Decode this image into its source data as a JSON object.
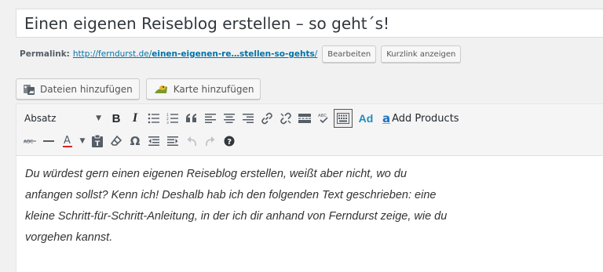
{
  "post": {
    "title": "Einen eigenen Reiseblog erstellen – so geht´s!",
    "permalink_label": "Permalink:",
    "permalink_base": "http://ferndurst.de/",
    "permalink_slug": "einen-eigenen-re…stellen-so-gehts",
    "permalink_trailing": "/",
    "edit_button": "Bearbeiten",
    "shortlink_button": "Kurzlink anzeigen"
  },
  "media": {
    "add_files": "Dateien hinzufügen",
    "add_map": "Karte hinzufügen"
  },
  "toolbar": {
    "format_select": "Absatz",
    "bold": "B",
    "italic": "I",
    "ad_label": "Ad",
    "amazon_letter": "a",
    "add_products": "Add Products",
    "icons_row1": [
      "bold-icon",
      "italic-icon",
      "bullet-list-icon",
      "numbered-list-icon",
      "blockquote-icon",
      "align-left-icon",
      "align-center-icon",
      "align-right-icon",
      "link-icon",
      "unlink-icon",
      "read-more-icon",
      "spellcheck-icon",
      "toolbar-toggle-icon",
      "ad-icon",
      "amazon-icon"
    ],
    "icons_row2": [
      "strikethrough-icon",
      "horizontal-line-icon",
      "text-color-icon",
      "paste-as-text-icon",
      "clear-formatting-icon",
      "special-character-icon",
      "outdent-icon",
      "indent-icon",
      "undo-icon",
      "redo-icon",
      "help-icon"
    ]
  },
  "content": {
    "lines": [
      "Du würdest gern einen eigenen Reiseblog erstellen, weißt aber nicht, wo du",
      "anfangen sollst? Kenn ich! Deshalb hab ich den folgenden Text geschrieben: eine",
      "kleine Schritt-für-Schritt-Anleitung, in der ich dir anhand von Ferndurst zeige, wie du",
      "vorgehen kannst."
    ]
  }
}
